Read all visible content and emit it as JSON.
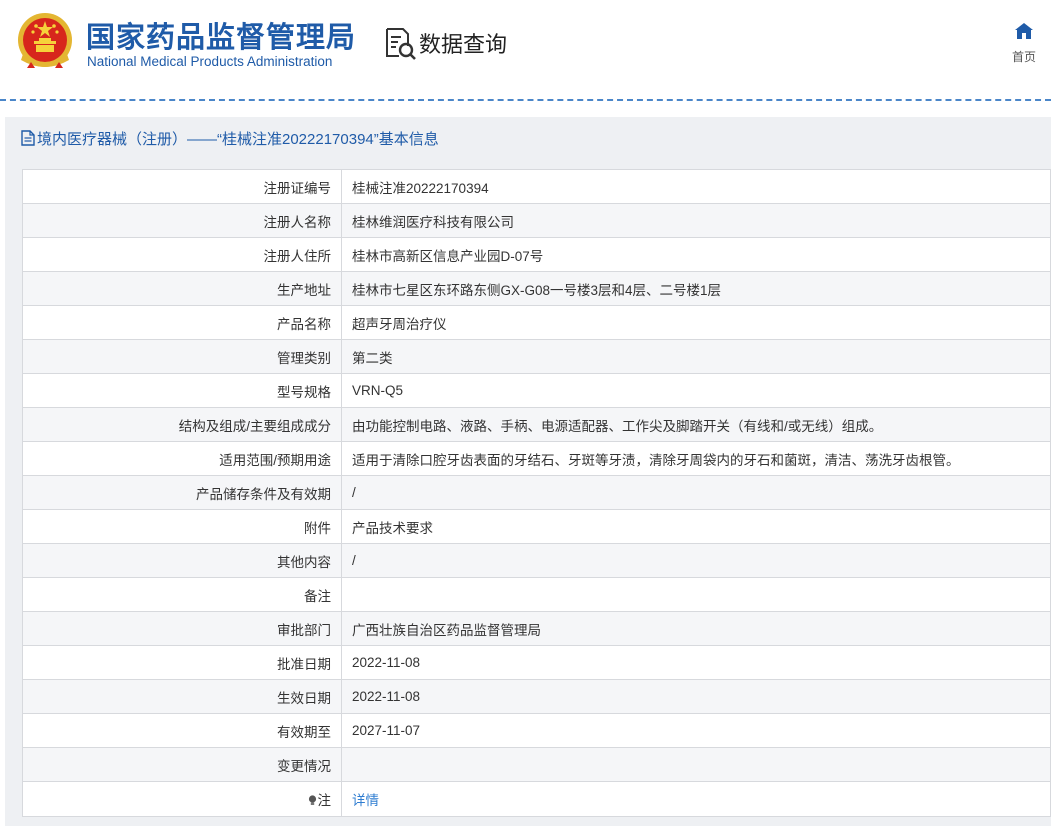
{
  "header": {
    "brand_cn": "国家药品监督管理局",
    "brand_en": "National Medical Products Administration",
    "query_label": "数据查询",
    "home_label": "首页",
    "accent_color": "#1f5ba8"
  },
  "panel": {
    "title": "境内医疗器械（注册）——“桂械注准20222170394”基本信息"
  },
  "rows": [
    {
      "label": "注册证编号",
      "value": "桂械注准20222170394"
    },
    {
      "label": "注册人名称",
      "value": "桂林维润医疗科技有限公司"
    },
    {
      "label": "注册人住所",
      "value": "桂林市高新区信息产业园D-07号"
    },
    {
      "label": "生产地址",
      "value": "桂林市七星区东环路东侧GX-G08一号楼3层和4层、二号楼1层"
    },
    {
      "label": "产品名称",
      "value": "超声牙周治疗仪"
    },
    {
      "label": "管理类别",
      "value": "第二类"
    },
    {
      "label": "型号规格",
      "value": "VRN-Q5"
    },
    {
      "label": "结构及组成/主要组成成分",
      "value": "由功能控制电路、液路、手柄、电源适配器、工作尖及脚踏开关（有线和/或无线）组成。"
    },
    {
      "label": "适用范围/预期用途",
      "value": "适用于清除口腔牙齿表面的牙结石、牙斑等牙渍，清除牙周袋内的牙石和菌斑，清洁、荡洗牙齿根管。"
    },
    {
      "label": "产品储存条件及有效期",
      "value": "/"
    },
    {
      "label": "附件",
      "value": "产品技术要求"
    },
    {
      "label": "其他内容",
      "value": "/"
    },
    {
      "label": "备注",
      "value": ""
    },
    {
      "label": "审批部门",
      "value": "广西壮族自治区药品监督管理局"
    },
    {
      "label": "批准日期",
      "value": "2022-11-08"
    },
    {
      "label": "生效日期",
      "value": "2022-11-08"
    },
    {
      "label": "有效期至",
      "value": "2027-11-07"
    },
    {
      "label": "变更情况",
      "value": ""
    }
  ],
  "note_row": {
    "label": "注",
    "link": "详情",
    "icon": "lightbulb-icon"
  }
}
